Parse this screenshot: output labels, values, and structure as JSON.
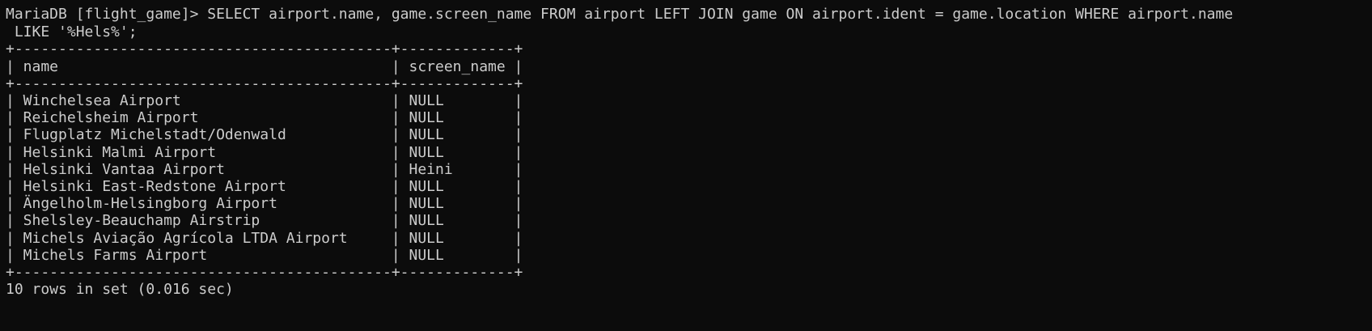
{
  "terminal": {
    "prompt": "MariaDB [flight_game]> ",
    "command_line1": "SELECT airport.name, game.screen_name FROM airport LEFT JOIN game ON airport.ident = game.location WHERE airport.name",
    "command_line2": " LIKE '%Hels%';",
    "border": "+-------------------------------------------+-------------+",
    "header_row": "| name                                      | screen_name |",
    "rows": [
      "| Winchelsea Airport                        | NULL        |",
      "| Reichelsheim Airport                      | NULL        |",
      "| Flugplatz Michelstadt/Odenwald            | NULL        |",
      "| Helsinki Malmi Airport                    | NULL        |",
      "| Helsinki Vantaa Airport                   | Heini       |",
      "| Helsinki East-Redstone Airport            | NULL        |",
      "| Ängelholm-Helsingborg Airport             | NULL        |",
      "| Shelsley-Beauchamp Airstrip               | NULL        |",
      "| Michels Aviação Agrícola LTDA Airport     | NULL        |",
      "| Michels Farms Airport                     | NULL        |"
    ],
    "footer": "10 rows in set (0.016 sec)",
    "colors": {
      "background": "#0c0c0c",
      "text": "#cccccc"
    }
  }
}
